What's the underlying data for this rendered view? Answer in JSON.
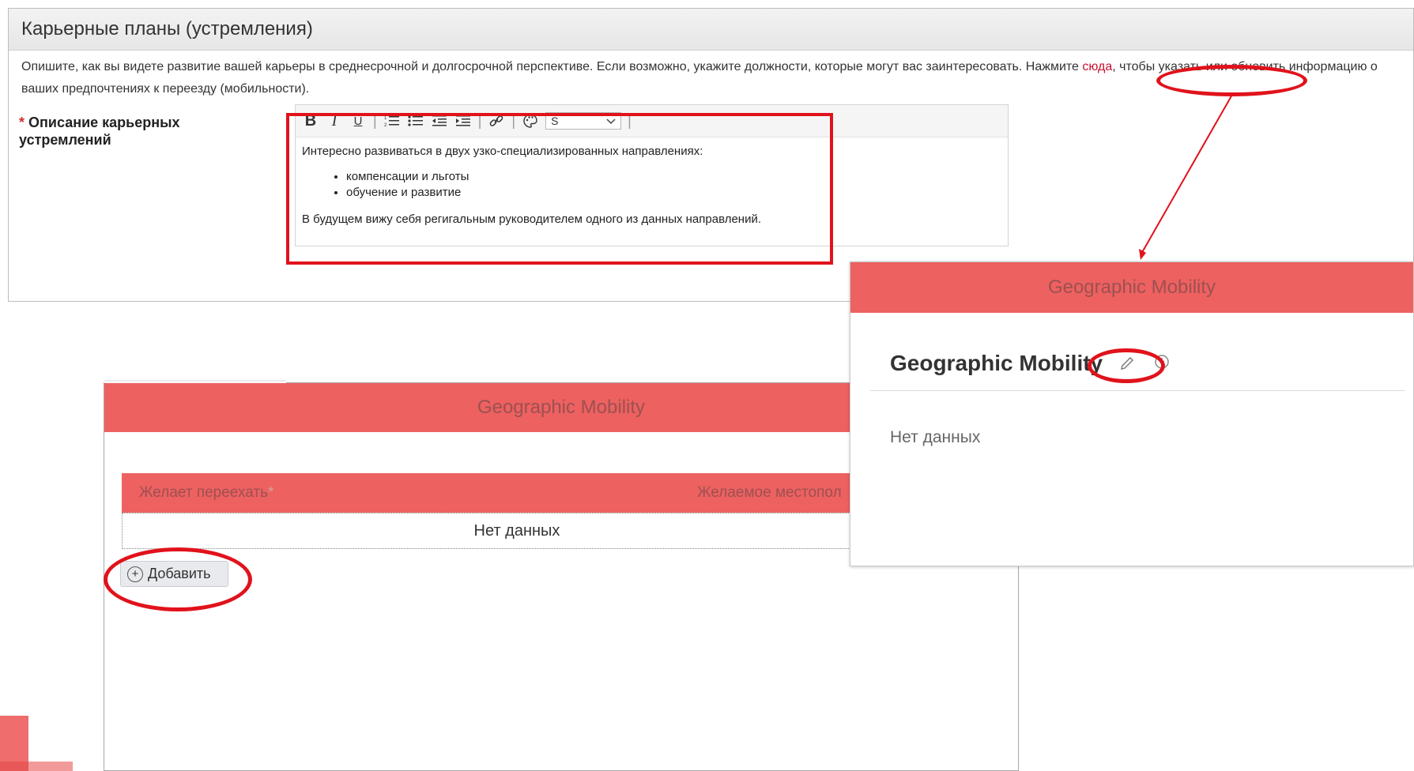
{
  "career": {
    "header": "Карьерные планы (устремления)",
    "desc_part1": "Опишите, как вы видете развитие вашей карьеры в среднесрочной и долгосрочной перспективе. Если возможно, укажите должности, которые могут вас заинтересовать. Нажмите ",
    "link_text": "сюда",
    "desc_part2": ", чтобы указать или обновить информацию о ваших предпочтениях к переезду (мобильности).",
    "field_required": "*",
    "field_label": "Описание карьерных устремлений",
    "toolbar": {
      "bold": "B",
      "italic": "I",
      "underline": "U",
      "sep": "|",
      "font_value": "S"
    },
    "editor": {
      "intro": "Интересно развиваться в двух узко-специализированных направлениях:",
      "bullets": [
        "компенсации и льготы",
        "обучение и развитие"
      ],
      "outro": "В будущем вижу себя регигальным руководителем одного из данных направлений."
    }
  },
  "mobility_view": {
    "header": "Geographic Mobility",
    "title": "Geographic Mobility",
    "no_data": "Нет данных"
  },
  "mobility_edit": {
    "header": "Geographic Mobility",
    "col1": "Желает переехать",
    "col1_required": "*",
    "col2": "Желаемое местопол",
    "no_data": "Нет данных",
    "add_label": "Добавить"
  },
  "colors": {
    "accent": "#ed6160",
    "annotation": "#e1121b",
    "link": "#c8102e"
  }
}
